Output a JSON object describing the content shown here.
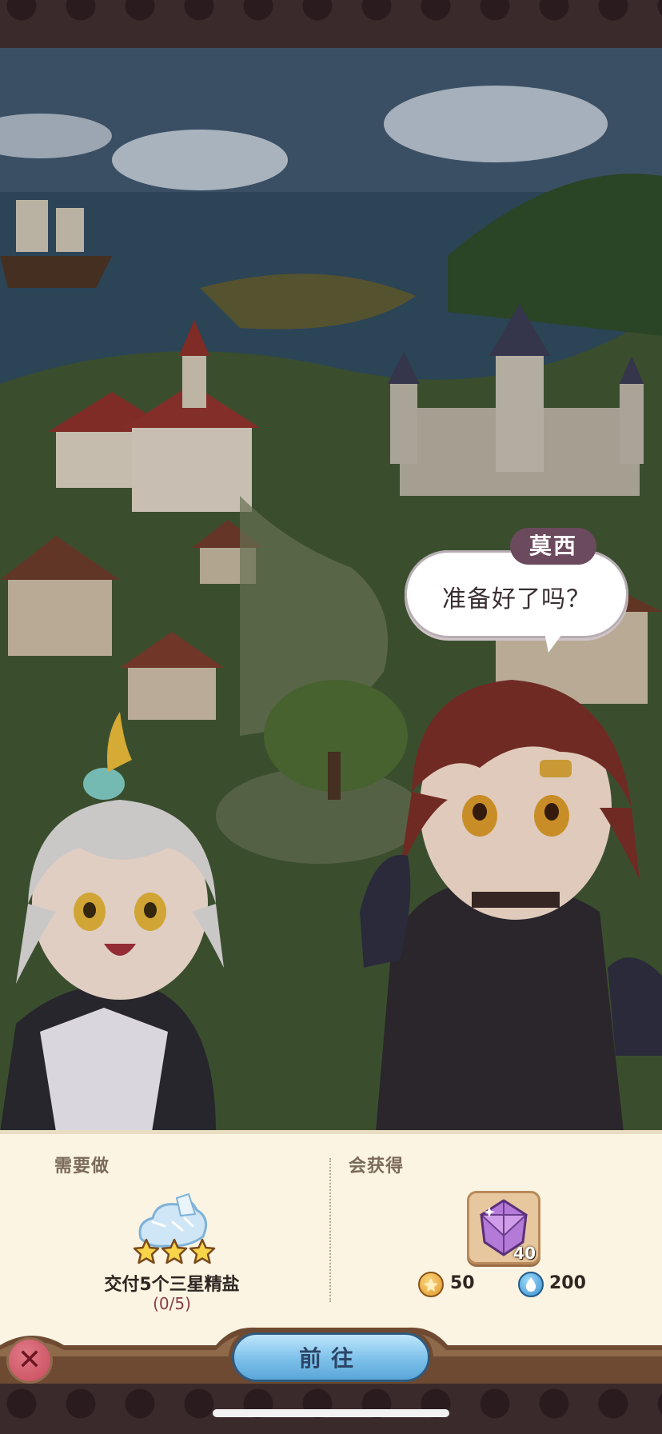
{
  "dialogue": {
    "speaker": "莫西",
    "text": "准备好了吗？"
  },
  "panel": {
    "todo_label": "需要做",
    "reward_label": "会获得",
    "task": {
      "icon": "star-salt-icon",
      "stars": 3,
      "text": "交付5个三星精盐",
      "progress": "(0/5)"
    },
    "rewards": {
      "item": {
        "icon": "purple-gem-icon",
        "count": "40"
      },
      "coins": {
        "icon": "gold-coin-icon",
        "value": "50"
      },
      "water": {
        "icon": "water-drop-icon",
        "value": "200"
      }
    }
  },
  "actions": {
    "go_label": "前往",
    "close_icon": "close-icon"
  },
  "colors": {
    "frame": "#3b2a2c",
    "panel_bg": "#fbf4e2",
    "name_tag": "#6b4a5d",
    "go_button": "#7cc0ea",
    "close_button": "#c84a5c"
  }
}
